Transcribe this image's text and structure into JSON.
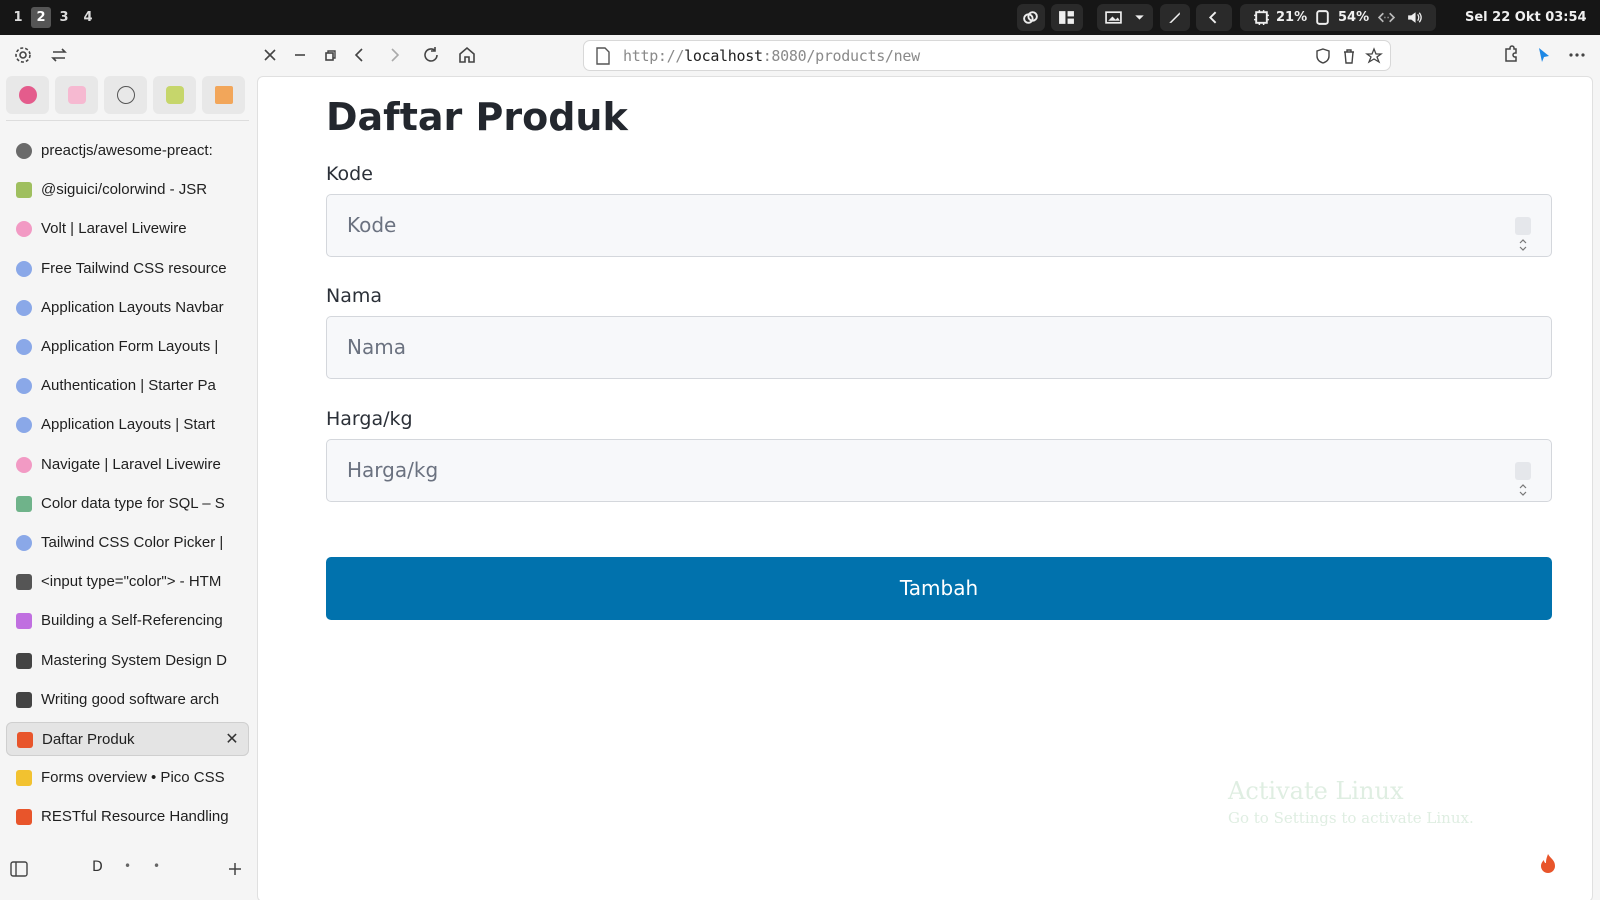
{
  "system_bar": {
    "workspaces": [
      "1",
      "2",
      "3",
      "4"
    ],
    "active_workspace": "2",
    "cpu": "21%",
    "memory": "54%",
    "datetime": "Sel 22 Okt  03:54"
  },
  "browser": {
    "url_prefix": "http://",
    "url_host": "localhost",
    "url_rest": ":8080/products/new"
  },
  "sidebar": {
    "tabs": [
      {
        "title": "preactjs/awesome-preact:",
        "favicon": "github-icon",
        "color": "#6a6a6a"
      },
      {
        "title": "@siguici/colorwind - JSR",
        "favicon": "jsr-icon",
        "color": "#9fbf5f"
      },
      {
        "title": "Volt | Laravel Livewire",
        "favicon": "livewire-icon",
        "color": "#f29ac4"
      },
      {
        "title": "Free Tailwind CSS resource",
        "favicon": "globe-icon",
        "color": "#8aa8e8"
      },
      {
        "title": "Application Layouts Navbar",
        "favicon": "globe-icon",
        "color": "#8aa8e8"
      },
      {
        "title": "Application Form Layouts |",
        "favicon": "globe-icon",
        "color": "#8aa8e8"
      },
      {
        "title": "Authentication | Starter Pa",
        "favicon": "globe-icon",
        "color": "#8aa8e8"
      },
      {
        "title": "Application Layouts | Start",
        "favicon": "globe-icon",
        "color": "#8aa8e8"
      },
      {
        "title": "Navigate | Laravel Livewire",
        "favicon": "livewire-icon",
        "color": "#f29ac4"
      },
      {
        "title": "Color data type for SQL – S",
        "favicon": "cube-icon",
        "color": "#6fb38a"
      },
      {
        "title": "Tailwind CSS Color Picker |",
        "favicon": "globe-icon",
        "color": "#8aa8e8"
      },
      {
        "title": "<input type=\"color\"> - HTM",
        "favicon": "mdn-icon",
        "color": "#555555"
      },
      {
        "title": "Building a Self-Referencing",
        "favicon": "g-icon",
        "color": "#c06fe0"
      },
      {
        "title": "Mastering System Design D",
        "favicon": "medium-icon",
        "color": "#444444"
      },
      {
        "title": "Writing good software arch",
        "favicon": "medium-icon",
        "color": "#444444"
      },
      {
        "title": "Daftar Produk",
        "favicon": "flame-icon",
        "color": "#e8552b",
        "active": true
      },
      {
        "title": "Forms overview • Pico CSS",
        "favicon": "sparkle-icon",
        "color": "#f2c230"
      },
      {
        "title": "RESTful Resource Handling",
        "favicon": "flame-icon",
        "color": "#e8552b"
      }
    ],
    "footer_label": "D"
  },
  "page": {
    "title": "Daftar Produk",
    "fields": [
      {
        "label": "Kode",
        "placeholder": "Kode",
        "type": "number"
      },
      {
        "label": "Nama",
        "placeholder": "Nama",
        "type": "text"
      },
      {
        "label": "Harga/kg",
        "placeholder": "Harga/kg",
        "type": "number"
      }
    ],
    "submit_label": "Tambah"
  },
  "watermark": {
    "line1": "Activate Linux",
    "line2": "Go to Settings to activate Linux."
  }
}
